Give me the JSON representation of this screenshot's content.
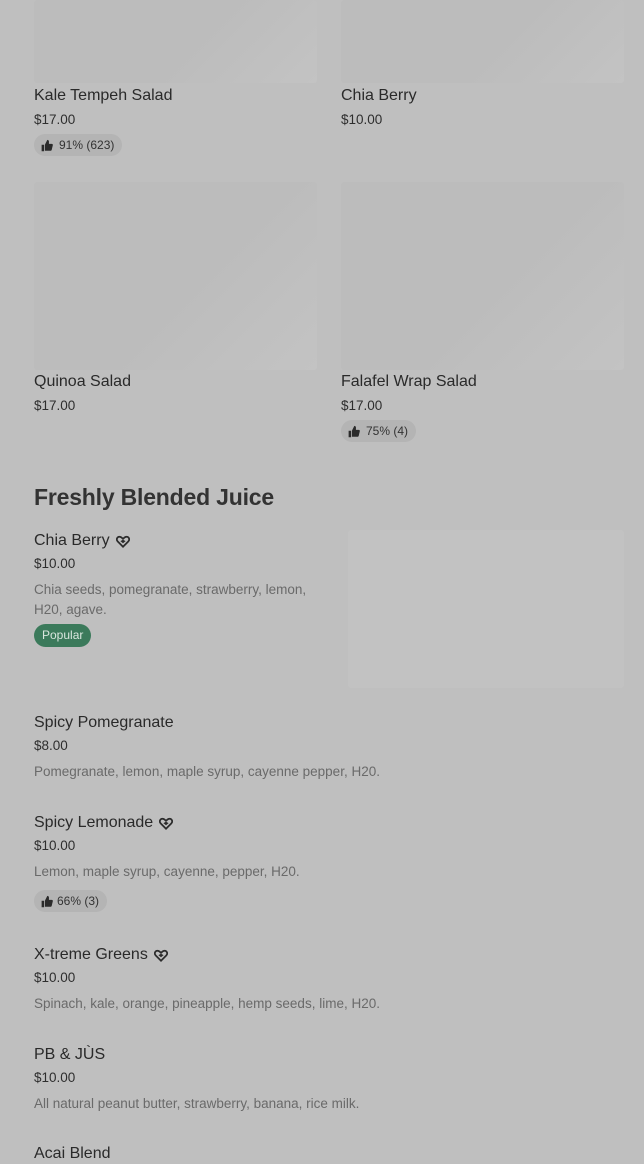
{
  "salads": [
    {
      "name": "Kale Tempeh Salad",
      "price": "$17.00",
      "rating": "91% (623)"
    },
    {
      "name": "Chia Berry",
      "price": "$10.00",
      "rating": null
    },
    {
      "name": "Quinoa Salad",
      "price": "$17.00",
      "rating": null
    },
    {
      "name": "Falafel Wrap Salad",
      "price": "$17.00",
      "rating": "75% (4)"
    }
  ],
  "juice_section": {
    "title": "Freshly Blended Juice",
    "items": [
      {
        "name": "Chia Berry",
        "price": "$10.00",
        "description": "Chia seeds, pomegranate, strawberry, lemon, H20, agave.",
        "badge": "Popular",
        "heart": true
      },
      {
        "name": "Spicy Pomegranate",
        "price": "$8.00",
        "description": "Pomegranate, lemon, maple syrup, cayenne pepper, H20."
      },
      {
        "name": "Spicy Lemonade",
        "price": "$10.00",
        "description": "Lemon, maple syrup, cayenne, pepper, H20.",
        "rating": "66% (3)",
        "heart": true
      },
      {
        "name": "X-treme Greens",
        "price": "$10.00",
        "description": "Spinach, kale, orange, pineapple, hemp seeds, lime, H20.",
        "heart": true
      },
      {
        "name": "PB & JÙS",
        "price": "$10.00",
        "description": "All natural peanut butter, strawberry, banana, rice milk."
      },
      {
        "name": "Acai Blend"
      }
    ]
  },
  "icons": {
    "thumbs_up": "thumbs-up-icon",
    "heart": "heart-icon"
  },
  "colors": {
    "background": "#bfbfbf",
    "popular_badge": "#3b7a5b"
  }
}
